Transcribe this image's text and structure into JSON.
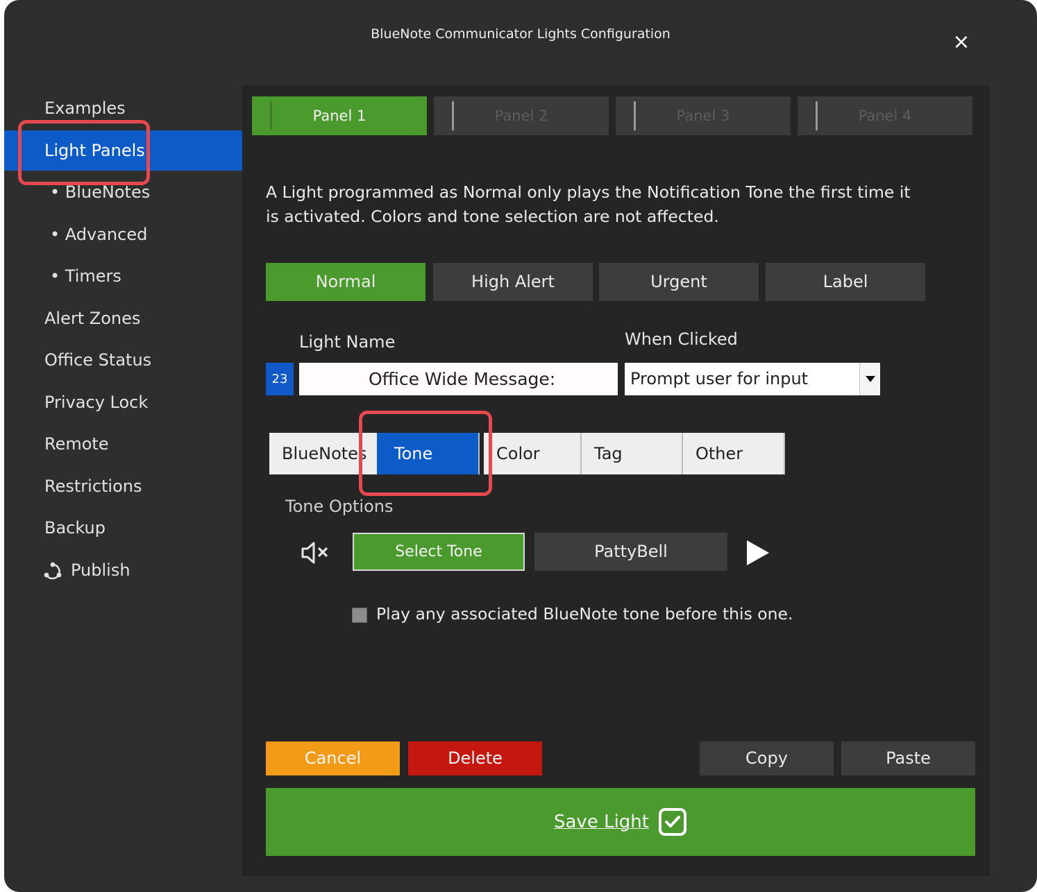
{
  "window": {
    "title": "BlueNote Communicator Lights Configuration",
    "close_label": "×"
  },
  "sidebar": {
    "items": [
      {
        "label": "Examples"
      },
      {
        "label": "Light Panels"
      },
      {
        "label": "• BlueNotes"
      },
      {
        "label": "• Advanced"
      },
      {
        "label": "• Timers"
      },
      {
        "label": "Alert Zones"
      },
      {
        "label": "Office Status"
      },
      {
        "label": "Privacy Lock"
      },
      {
        "label": "Remote"
      },
      {
        "label": "Restrictions"
      },
      {
        "label": "Backup"
      },
      {
        "label": "Publish",
        "icon": "network-icon"
      }
    ],
    "active": "Light Panels"
  },
  "panel_tabs": [
    {
      "label": "Panel 1"
    },
    {
      "label": "Panel 2"
    },
    {
      "label": "Panel 3"
    },
    {
      "label": "Panel 4"
    }
  ],
  "description": "A Light programmed as Normal only plays the Notification Tone the first time it is activated. Colors and tone selection are not affected.",
  "modes": [
    {
      "label": "Normal"
    },
    {
      "label": "High Alert"
    },
    {
      "label": "Urgent"
    },
    {
      "label": "Label"
    }
  ],
  "light_name": {
    "label": "Light Name",
    "number": "23",
    "value": "Office Wide Message:"
  },
  "when_clicked": {
    "label": "When Clicked",
    "value": "Prompt user for input"
  },
  "sub_tabs": [
    {
      "label": "BlueNotes"
    },
    {
      "label": "Tone"
    },
    {
      "label": "Color"
    },
    {
      "label": "Tag"
    },
    {
      "label": "Other"
    }
  ],
  "tone_options": {
    "title": "Tone Options",
    "select_label": "Select Tone",
    "current_tone": "PattyBell",
    "checkbox_label": "Play any associated BlueNote tone before this one.",
    "checkbox_checked": false
  },
  "actions": {
    "cancel": "Cancel",
    "delete": "Delete",
    "copy": "Copy",
    "paste": "Paste",
    "save": "Save Light"
  },
  "colors": {
    "green": "#4a9a2e",
    "blue": "#0d5bc7",
    "orange": "#f29b17",
    "red": "#c3170f",
    "highlight": "#e5484d"
  }
}
